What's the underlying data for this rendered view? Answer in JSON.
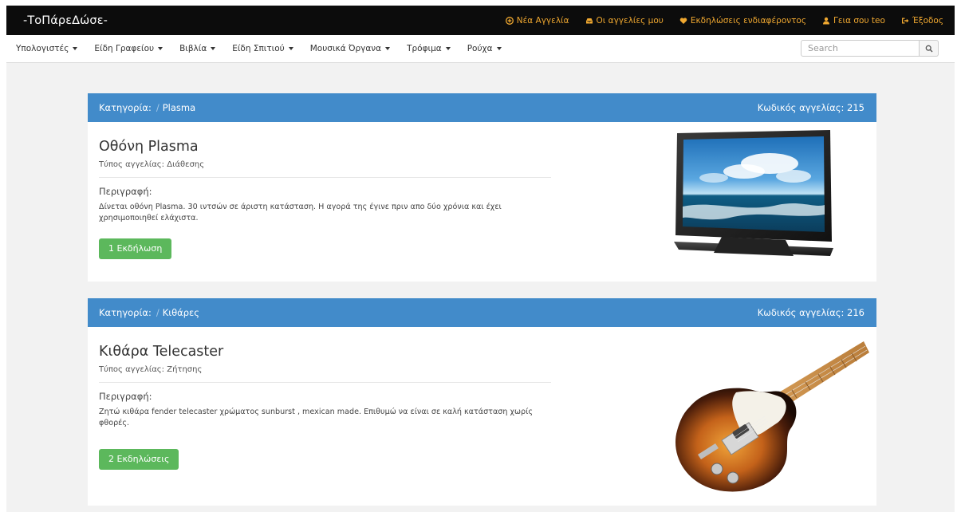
{
  "brand": "-ΤοΠάρεΔώσε-",
  "top_nav": {
    "new_ad": "Νέα Αγγελία",
    "my_ads": "Οι αγγελίες μου",
    "interests": "Εκδηλώσεις ενδιαφέροντος",
    "greeting": "Γεια σου teo",
    "logout": "Έξοδος"
  },
  "categories": [
    "Υπολογιστές",
    "Είδη Γραφείου",
    "Βιβλία",
    "Είδη Σπιτιού",
    "Μουσικά Όργανα",
    "Τρόφιμα",
    "Ρούχα"
  ],
  "search": {
    "placeholder": "Search",
    "value": ""
  },
  "ads": [
    {
      "category_label": "Κατηγορία:",
      "category": "Plasma",
      "code_label": "Κωδικός αγγελίας:",
      "code": "215",
      "title": "Οθόνη Plasma",
      "type_label": "Τύπος αγγελίας:",
      "type": "Διάθεσης",
      "desc_label": "Περιγραφή:",
      "description": "Δίνεται οθόνη Plasma. 30 ιντσών σε άριστη κατάσταση. Η αγορά της έγινε πριν απο δύο χρόνια και έχει χρησιμοποιηθεί ελάχιστα.",
      "button": "1 Εκδήλωση",
      "image": "plasma-tv-image"
    },
    {
      "category_label": "Κατηγορία:",
      "category": "Κιθάρες",
      "code_label": "Κωδικός αγγελίας:",
      "code": "216",
      "title": "Κιθάρα Telecaster",
      "type_label": "Τύπος αγγελίας:",
      "type": "Ζήτησης",
      "desc_label": "Περιγραφή:",
      "description": "Ζητώ κιθάρα fender telecaster χρώματος sunburst , mexican made. Επιθυμώ να είναι σε καλή κατάσταση χωρίς φθορές.",
      "button": "2 Εκδηλώσεις",
      "image": "telecaster-guitar-image"
    }
  ],
  "colors": {
    "topbar": "#0c0c0c",
    "topbar_link": "#f0a830",
    "card_header": "#428bca",
    "button": "#5cb85c",
    "background": "#f2f2f2"
  }
}
